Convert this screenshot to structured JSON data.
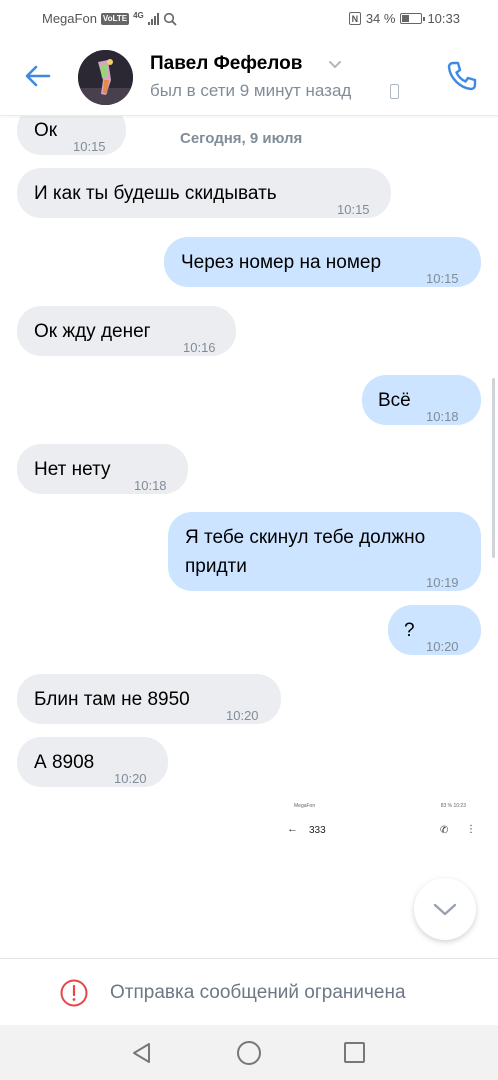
{
  "status_bar": {
    "carrier": "MegaFon",
    "volte": "VoLTE",
    "network": "4G",
    "nfc": "N",
    "battery_text": "34 %",
    "battery_level": 0.34,
    "time": "10:33"
  },
  "header": {
    "contact_name": "Павел Фефелов",
    "last_seen": "был в сети 9 минут назад"
  },
  "chat": {
    "date_separator": "Сегодня, 9 июля",
    "messages": [
      {
        "direction": "in",
        "text": "Ок",
        "time": "10:15"
      },
      {
        "direction": "in",
        "text": "И как ты будешь скидывать",
        "time": "10:15"
      },
      {
        "direction": "out",
        "text": "Через номер на номер",
        "time": "10:15"
      },
      {
        "direction": "in",
        "text": "Ок жду денег",
        "time": "10:16"
      },
      {
        "direction": "out",
        "text": "Всё",
        "time": "10:18"
      },
      {
        "direction": "in",
        "text": "Нет нету",
        "time": "10:18"
      },
      {
        "direction": "out",
        "text": "Я тебе скинул тебе должно придти",
        "time": "10:19"
      },
      {
        "direction": "out",
        "text": "?",
        "time": "10:20"
      },
      {
        "direction": "in",
        "text": "Блин там не 8950",
        "time": "10:20"
      },
      {
        "direction": "in",
        "text": "А 8908",
        "time": "10:20"
      }
    ],
    "attachment": {
      "status_left": "MegaFon",
      "status_right": "83 % 10:23",
      "number": "333"
    }
  },
  "footer": {
    "restricted_text": "Отправка сообщений ограничена"
  },
  "colors": {
    "accent": "#3f8ae0",
    "incoming_bubble": "#ebedf0",
    "outgoing_bubble": "#cce4ff",
    "secondary_text": "#818c99",
    "warning": "#e64646"
  },
  "icons": {
    "back": "arrow-left-icon",
    "call": "phone-icon",
    "scroll_down": "chevron-down-icon",
    "warning": "exclamation-circle-icon"
  }
}
